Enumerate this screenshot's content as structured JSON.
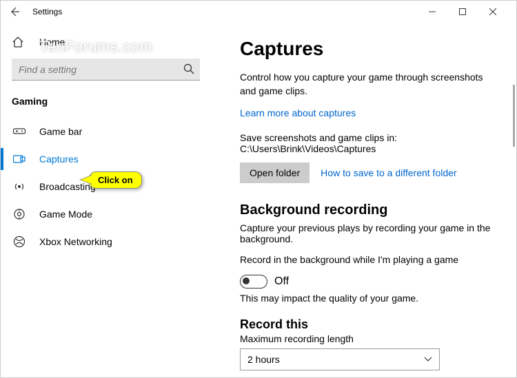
{
  "window": {
    "title": "Settings"
  },
  "sidebar": {
    "home_label": "Home",
    "search_placeholder": "Find a setting",
    "category": "Gaming",
    "items": [
      {
        "label": "Game bar"
      },
      {
        "label": "Captures"
      },
      {
        "label": "Broadcasting"
      },
      {
        "label": "Game Mode"
      },
      {
        "label": "Xbox Networking"
      }
    ],
    "active_index": 1
  },
  "main": {
    "heading": "Captures",
    "intro": "Control how you capture your game through screenshots and game clips.",
    "learn_more": "Learn more about captures",
    "save_path_label": "Save screenshots and game clips in: C:\\Users\\Brink\\Videos\\Captures",
    "open_folder_label": "Open folder",
    "how_to_link": "How to save to a different folder",
    "bg_heading": "Background recording",
    "bg_sub": "Capture your previous plays by recording your game in the background.",
    "bg_toggle_label": "Record in the background while I'm playing a game",
    "bg_toggle_state": "Off",
    "impact_note": "This may impact the quality of your game.",
    "record_heading": "Record this",
    "max_length_label": "Maximum recording length",
    "dropdown_value": "2 hours"
  },
  "annotation": {
    "callout": "Click on",
    "watermark": "TenForums.com"
  }
}
